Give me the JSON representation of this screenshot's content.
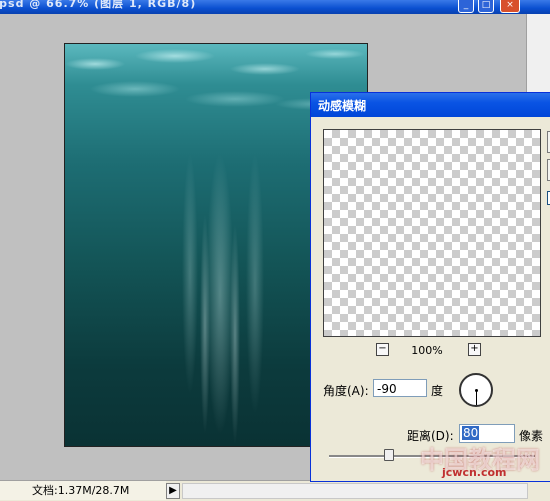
{
  "document": {
    "title_fragment": ".psd @ 66.7% (图层 1, RGB/8)",
    "status_doc_label": "文档:1.37M/28.7M",
    "status_arrow_icon": "triangle-right-icon"
  },
  "window_controls": {
    "minimize_icon": "minimize-icon",
    "maximize_icon": "maximize-icon",
    "close_icon": "close-icon"
  },
  "dialog": {
    "title": "动感模糊",
    "zoom": {
      "out_symbol": "−",
      "in_symbol": "+",
      "level": "100%"
    },
    "angle": {
      "label": "角度(A):",
      "value": "-90",
      "unit": "度",
      "dial_icon": "angle-dial-icon"
    },
    "distance": {
      "label": "距离(D):",
      "value": "80",
      "unit": "像素",
      "slider_value": 80
    }
  },
  "watermark": {
    "text": "中国教程网",
    "url": "jcwcn.com"
  }
}
